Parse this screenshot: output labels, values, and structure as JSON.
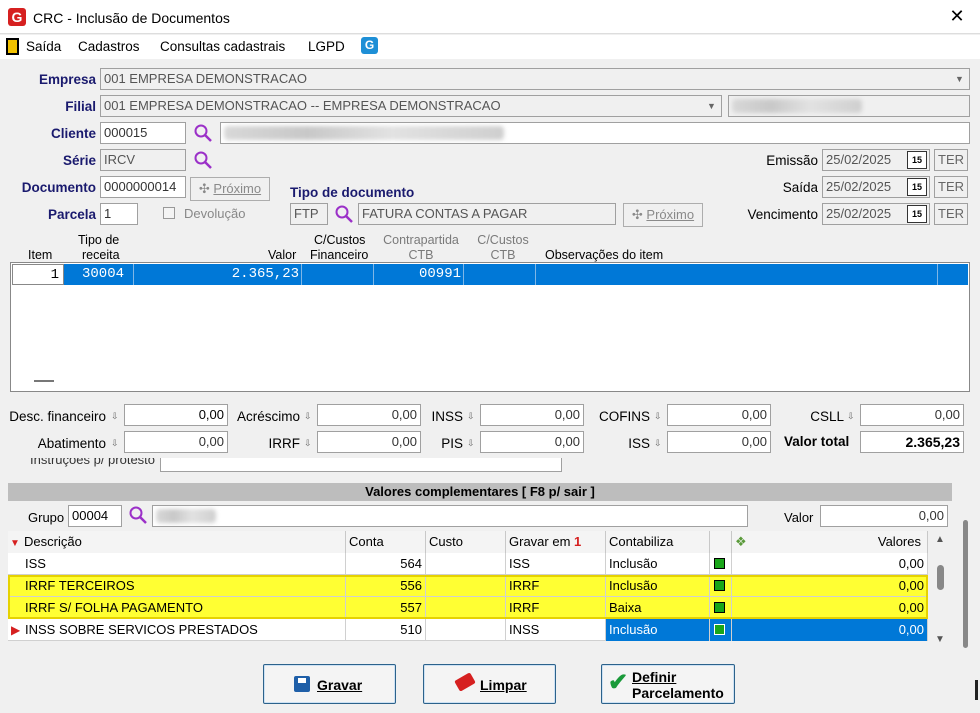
{
  "window": {
    "title": "CRC - Inclusão de Documentos",
    "close": "✕",
    "logo": "G"
  },
  "menu": {
    "items": [
      "Saída",
      "Cadastros",
      "Consultas cadastrais",
      "LGPD"
    ],
    "g_icon": "G"
  },
  "form": {
    "empresa_label": "Empresa",
    "empresa_value": "001 EMPRESA DEMONSTRACAO",
    "filial_label": "Filial",
    "filial_value": "001 EMPRESA DEMONSTRACAO -- EMPRESA DEMONSTRACAO",
    "cliente_label": "Cliente",
    "cliente_value": "000015",
    "serie_label": "Série",
    "serie_value": "IRCV",
    "documento_label": "Documento",
    "documento_value": "0000000014",
    "proximo_label": "Próximo",
    "parcela_label": "Parcela",
    "parcela_value": "1",
    "devolucao_label": "Devolução",
    "tipo_doc_label": "Tipo de documento",
    "tipo_doc_code": "FTP",
    "tipo_doc_desc": "FATURA CONTAS A PAGAR",
    "emissao_label": "Emissão",
    "emissao_value": "25/02/2025",
    "emissao_dow": "TER",
    "saida_label": "Saída",
    "saida_value": "25/02/2025",
    "saida_dow": "TER",
    "vencimento_label": "Vencimento",
    "vencimento_value": "25/02/2025",
    "vencimento_dow": "TER",
    "cal_glyph": "15"
  },
  "items_grid": {
    "headers": {
      "item": "Item",
      "tipo1": "Tipo de",
      "tipo2": "receita",
      "valor": "Valor",
      "cc1": "C/Custos",
      "cc2": "Financeiro",
      "cp1": "Contrapartida",
      "cp2": "CTB",
      "cc3": "C/Custos",
      "cc4": "CTB",
      "obs": "Observações do item"
    },
    "row": {
      "item": "1",
      "tipo": "30004",
      "valor": "2.365,23",
      "contrapartida": "00991"
    }
  },
  "totals": {
    "desc_fin_label": "Desc. financeiro",
    "desc_fin": "0,00",
    "acrescimo_label": "Acréscimo",
    "acrescimo": "0,00",
    "inss_label": "INSS",
    "inss": "0,00",
    "cofins_label": "COFINS",
    "cofins": "0,00",
    "csll_label": "CSLL",
    "csll": "0,00",
    "abatimento_label": "Abatimento",
    "abatimento": "0,00",
    "irrf_label": "IRRF",
    "irrf": "0,00",
    "pis_label": "PIS",
    "pis": "0,00",
    "iss_label": "ISS",
    "iss": "0,00",
    "valor_total_label": "Valor total",
    "valor_total": "2.365,23"
  },
  "complementares": {
    "partial_label": "Instruções p/ protesto",
    "header": "Valores complementares [ F8 p/ sair ]",
    "grupo_label": "Grupo",
    "grupo_value": "00004",
    "valor_label": "Valor",
    "valor_value": "0,00",
    "columns": [
      "Descrição",
      "Conta",
      "Custo",
      "Gravar em",
      "Contabiliza",
      "",
      "Valores"
    ],
    "rows": [
      {
        "descricao": "ISS",
        "conta": "564",
        "custo": "",
        "gravar": "ISS",
        "contabiliza": "Inclusão",
        "valores": "0,00"
      },
      {
        "descricao": "IRRF TERCEIROS",
        "conta": "556",
        "custo": "",
        "gravar": "IRRF",
        "contabiliza": "Inclusão",
        "valores": "0,00"
      },
      {
        "descricao": "IRRF S/ FOLHA PAGAMENTO",
        "conta": "557",
        "custo": "",
        "gravar": "IRRF",
        "contabiliza": "Baixa",
        "valores": "0,00"
      },
      {
        "descricao": "INSS SOBRE SERVICOS PRESTADOS",
        "conta": "510",
        "custo": "",
        "gravar": "INSS",
        "contabiliza": "Inclusão",
        "valores": "0,00"
      }
    ]
  },
  "buttons": {
    "gravar": "Gravar",
    "limpar": "Limpar",
    "definir1": "Definir",
    "definir2": "Parcelamento"
  },
  "colors": {
    "selection": "#0078d7",
    "highlight": "#ffff33",
    "label_blue": "#1a1a6e",
    "accent_red": "#d62020"
  }
}
